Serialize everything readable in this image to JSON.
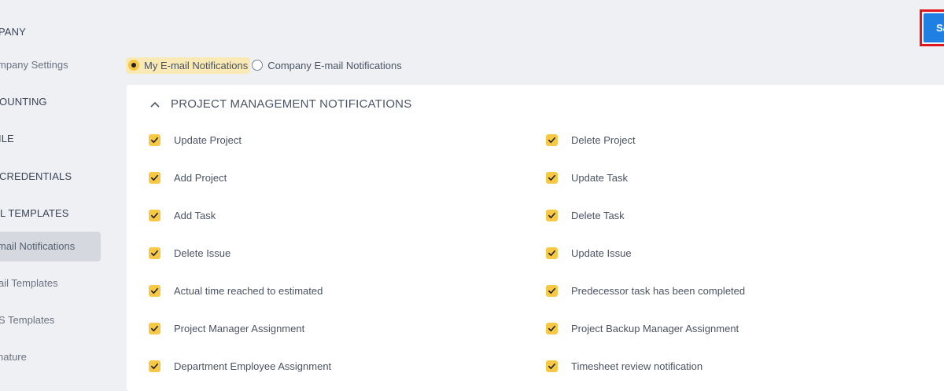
{
  "sidebar": {
    "items": [
      {
        "label": "PANY",
        "kind": "section"
      },
      {
        "label": "mpany Settings",
        "kind": "link"
      },
      {
        "label": "OUNTING",
        "kind": "section"
      },
      {
        "label": "ILE",
        "kind": "section"
      },
      {
        "label": " CREDENTIALS",
        "kind": "section"
      },
      {
        "label": "L TEMPLATES",
        "kind": "section"
      },
      {
        "label": "mail Notifications",
        "kind": "active"
      },
      {
        "label": "ail Templates",
        "kind": "link"
      },
      {
        "label": "S Templates",
        "kind": "link"
      },
      {
        "label": "nature",
        "kind": "link"
      }
    ]
  },
  "toolbar": {
    "save_label": "Sa"
  },
  "radio": {
    "my_label": "My E-mail Notifications",
    "company_label": "Company E-mail Notifications",
    "selected": "my"
  },
  "panel": {
    "title": "PROJECT MANAGEMENT NOTIFICATIONS",
    "left": [
      {
        "label": "Update Project",
        "checked": true
      },
      {
        "label": "Add Project",
        "checked": true
      },
      {
        "label": "Add Task",
        "checked": true
      },
      {
        "label": "Delete Issue",
        "checked": true
      },
      {
        "label": "Actual time reached to estimated",
        "checked": true
      },
      {
        "label": "Project Manager Assignment",
        "checked": true
      },
      {
        "label": "Department Employee Assignment",
        "checked": true
      }
    ],
    "right": [
      {
        "label": "Delete Project",
        "checked": true
      },
      {
        "label": "Update Task",
        "checked": true
      },
      {
        "label": "Delete Task",
        "checked": true
      },
      {
        "label": "Update Issue",
        "checked": true
      },
      {
        "label": "Predecessor task has been completed",
        "checked": true
      },
      {
        "label": "Project Backup Manager Assignment",
        "checked": true
      },
      {
        "label": "Timesheet review notification",
        "checked": true
      }
    ]
  },
  "colors": {
    "accent": "#1f7fe3",
    "check": "#f7c843",
    "highlight": "#e0161e"
  }
}
